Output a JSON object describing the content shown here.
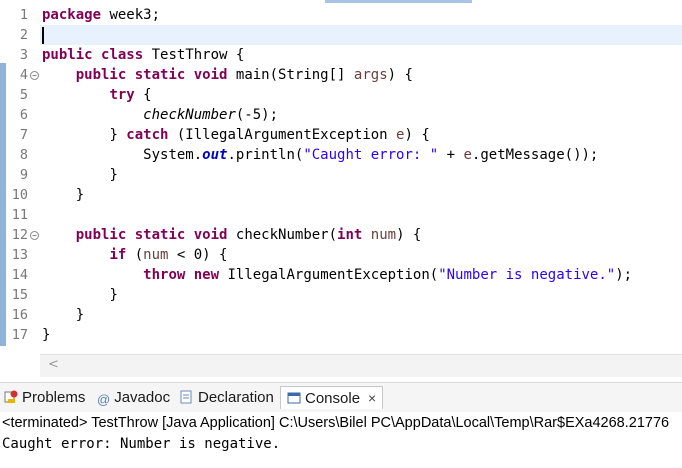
{
  "editor": {
    "lines": [
      {
        "n": "1"
      },
      {
        "n": "2"
      },
      {
        "n": "3"
      },
      {
        "n": "4"
      },
      {
        "n": "5"
      },
      {
        "n": "6"
      },
      {
        "n": "7"
      },
      {
        "n": "8"
      },
      {
        "n": "9"
      },
      {
        "n": "10"
      },
      {
        "n": "11"
      },
      {
        "n": "12"
      },
      {
        "n": "13"
      },
      {
        "n": "14"
      },
      {
        "n": "15"
      },
      {
        "n": "16"
      },
      {
        "n": "17"
      }
    ],
    "tokens": {
      "l1_kw": "package",
      "l1_rest": " week3;",
      "l3_kw1": "public",
      "l3_kw2": "class",
      "l3_rest": " TestThrow {",
      "l4_kw1": "public",
      "l4_kw2": "static",
      "l4_kw3": "void",
      "l4_mid": " main(String[] ",
      "l4_var": "args",
      "l4_end": ") {",
      "l5_kw": "try",
      "l5_rest": " {",
      "l6_mth": "checkNumber",
      "l6_rest": "(-5);",
      "l7_a": "} ",
      "l7_kw": "catch",
      "l7_mid": " (IllegalArgumentException ",
      "l7_var": "e",
      "l7_end": ") {",
      "l8_a": "System.",
      "l8_fld": "out",
      "l8_b": ".println(",
      "l8_str": "\"Caught error: \"",
      "l8_c": " + ",
      "l8_var": "e",
      "l8_d": ".getMessage());",
      "l9": "}",
      "l10": "}",
      "l12_kw1": "public",
      "l12_kw2": "static",
      "l12_kw3": "void",
      "l12_mid": " checkNumber(",
      "l12_kw4": "int",
      "l12_sp": " ",
      "l12_var": "num",
      "l12_end": ") {",
      "l13_kw": "if",
      "l13_a": " (",
      "l13_var": "num",
      "l13_b": " < 0) {",
      "l14_kw1": "throw",
      "l14_kw2": "new",
      "l14_mid": " IllegalArgumentException(",
      "l14_str": "\"Number is negative.\"",
      "l14_end": ");",
      "l15": "}",
      "l16": "}",
      "l17": "}"
    },
    "scroll_arrow": "<"
  },
  "console_tabs": {
    "problems": "Problems",
    "javadoc": "Javadoc",
    "declaration": "Declaration",
    "console": "Console",
    "close": "×"
  },
  "status_line": "<terminated> TestThrow [Java Application] C:\\Users\\Bilel PC\\AppData\\Local\\Temp\\Rar$EXa4268.21776",
  "output_line": "Caught error: Number is negative.",
  "colors": {
    "keyword": "#7f0055",
    "string": "#2a00ff",
    "field": "#0000c0",
    "variable": "#6a3e3e"
  }
}
